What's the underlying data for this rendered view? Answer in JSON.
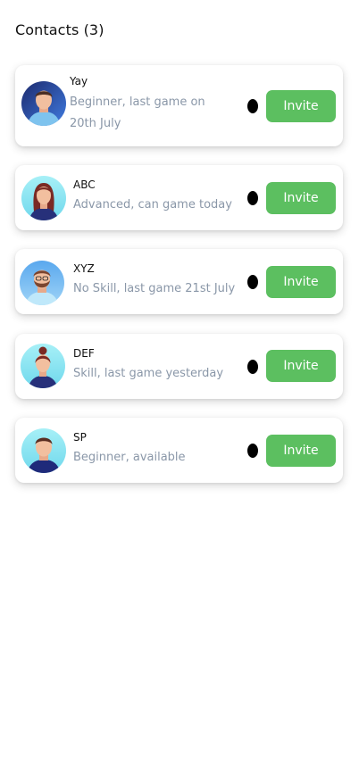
{
  "header": {
    "title": "Contacts (3)"
  },
  "contacts": [
    {
      "name": "Yay",
      "description": "Beginner, last game on 20th July",
      "invite_label": "Invite",
      "avatar_icon": "male-avatar-icon",
      "avatar_bg": "#2a4fb8"
    },
    {
      "name": "ABC",
      "description": "Advanced, can game today",
      "invite_label": "Invite",
      "avatar_icon": "female-avatar-icon",
      "avatar_bg": "#8fe6f2"
    },
    {
      "name": "XYZ",
      "description": "No Skill, last game 21st July",
      "invite_label": "Invite",
      "avatar_icon": "bearded-male-avatar-icon",
      "avatar_bg": "#6fb6f0"
    },
    {
      "name": "DEF",
      "description": "Skill, last game yesterday",
      "invite_label": "Invite",
      "avatar_icon": "female-avatar-icon",
      "avatar_bg": "#8fe6f2"
    },
    {
      "name": "SP",
      "description": "Beginner, available",
      "invite_label": "Invite",
      "avatar_icon": "male-avatar-icon",
      "avatar_bg": "#8fe6f2"
    }
  ],
  "colors": {
    "invite_button": "#5cbf60",
    "description_text": "#8a97a8",
    "status_dot": "#000000"
  }
}
